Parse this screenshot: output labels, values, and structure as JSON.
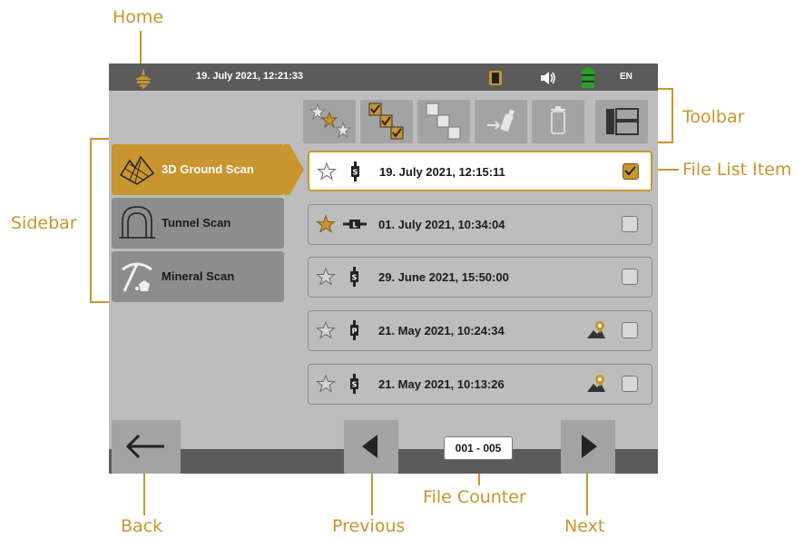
{
  "callouts": {
    "home": "Home",
    "toolbar": "Toolbar",
    "file_list_item": "File List Item",
    "sidebar": "Sidebar",
    "back": "Back",
    "previous": "Previous",
    "file_counter": "File Counter",
    "next": "Next"
  },
  "statusbar": {
    "datetime": "19. July 2021, 12:21:33",
    "language": "EN",
    "icons": [
      "home-icon",
      "device-icon",
      "volume-icon",
      "battery-icon"
    ]
  },
  "toolbar": {
    "buttons": [
      "favorites-icon",
      "check-multiple-icon",
      "uncheck-multiple-icon",
      "usb-export-icon",
      "trash-icon",
      "layout-icon"
    ]
  },
  "sidebar": {
    "items": [
      {
        "label": "3D Ground Scan",
        "icon": "ground-scan-icon",
        "active": true
      },
      {
        "label": "Tunnel Scan",
        "icon": "tunnel-icon",
        "active": false
      },
      {
        "label": "Mineral Scan",
        "icon": "pickaxe-icon",
        "active": false
      }
    ]
  },
  "files": [
    {
      "date": "19. July 2021, 12:15:11",
      "favorite": false,
      "mode": "S",
      "geo": false,
      "checked": true,
      "selected": true
    },
    {
      "date": "01. July 2021, 10:34:04",
      "favorite": true,
      "mode": "L",
      "geo": false,
      "checked": false,
      "selected": false
    },
    {
      "date": "29. June 2021, 15:50:00",
      "favorite": false,
      "mode": "S",
      "geo": false,
      "checked": false,
      "selected": false
    },
    {
      "date": "21. May 2021, 10:24:34",
      "favorite": false,
      "mode": "P",
      "geo": true,
      "checked": false,
      "selected": false
    },
    {
      "date": "21. May 2021, 10:13:26",
      "favorite": false,
      "mode": "S",
      "geo": true,
      "checked": false,
      "selected": false
    }
  ],
  "pager": {
    "counter": "001 - 005"
  },
  "colors": {
    "accent": "#c8952f",
    "panel": "#bdbdbd",
    "bar": "#5b5b5b",
    "button": "#a3a3a3"
  }
}
